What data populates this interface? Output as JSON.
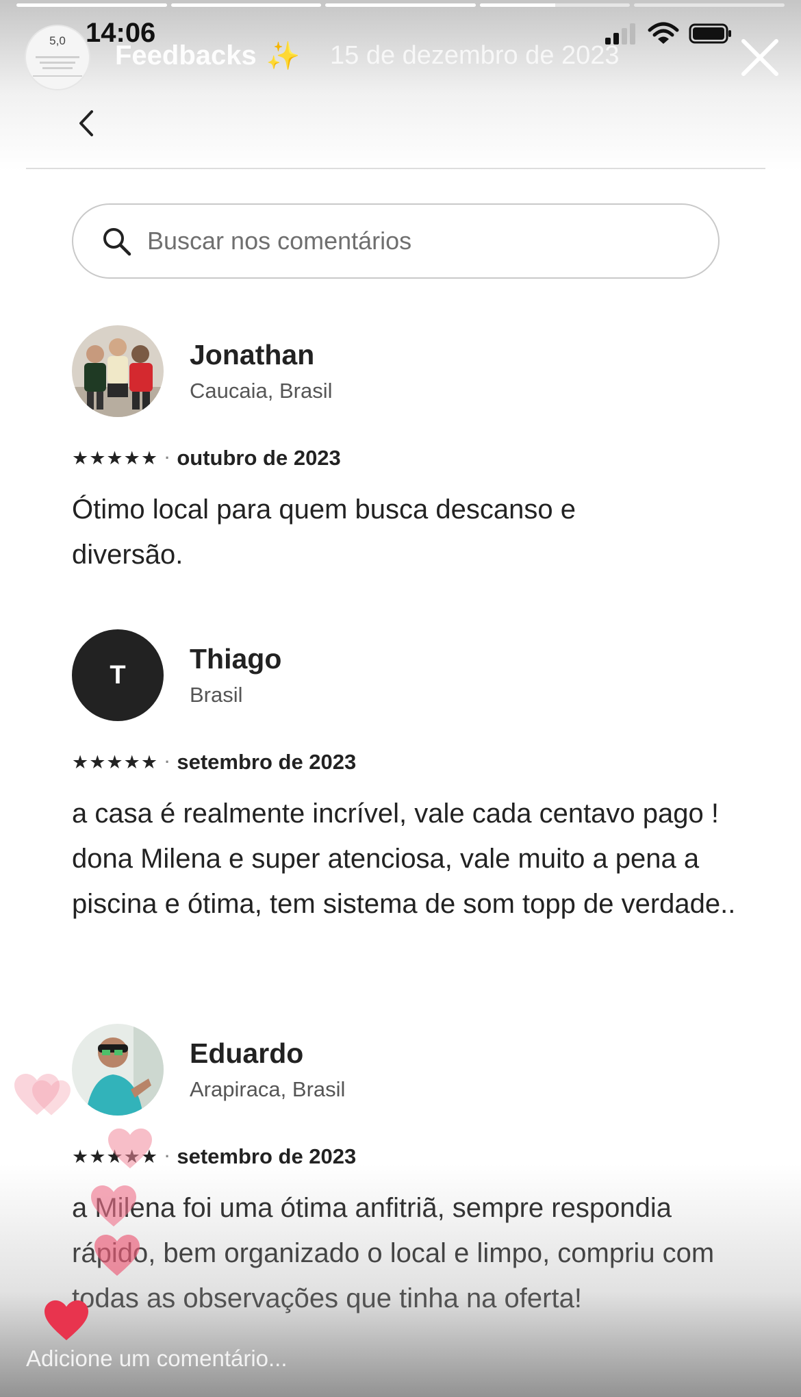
{
  "story": {
    "progress_segments": [
      1,
      1,
      1,
      0.5,
      0
    ],
    "avatar_rating": "5,0",
    "title": "Feedbacks",
    "title_emoji": "✨",
    "date": "15 de dezembro de 2023"
  },
  "status_bar": {
    "time": "14:06"
  },
  "search": {
    "placeholder": "Buscar nos comentários"
  },
  "reviews": [
    {
      "name": "Jonathan",
      "location": "Caucaia, Brasil",
      "stars": "★★★★★",
      "date": "outubro de 2023",
      "text": "Ótimo local para quem busca descanso e diversão."
    },
    {
      "name": "Thiago",
      "initial": "T",
      "location": "Brasil",
      "stars": "★★★★★",
      "date": "setembro de 2023",
      "text": "a casa é realmente incrível, vale cada centavo pago ! dona Milena e super atenciosa, vale muito a pena a piscina e ótima, tem sistema de som topp de verdade.."
    },
    {
      "name": "Eduardo",
      "location": "Arapiraca, Brasil",
      "stars": "★★★★★",
      "date": "setembro de 2023",
      "text": "a Milena foi uma ótima anfitriã, sempre respondia rápido, bem organizado o local e limpo, compriu com todas as observações que tinha na oferta!"
    }
  ],
  "comment": {
    "placeholder": "Adicione um comentário..."
  },
  "colors": {
    "heart": "#e8344e",
    "heart_faded": "#f28a9c"
  },
  "icons": [
    "search-icon",
    "chevron-left-icon",
    "close-icon",
    "signal-icon",
    "wifi-icon",
    "battery-icon",
    "heart-icon"
  ]
}
